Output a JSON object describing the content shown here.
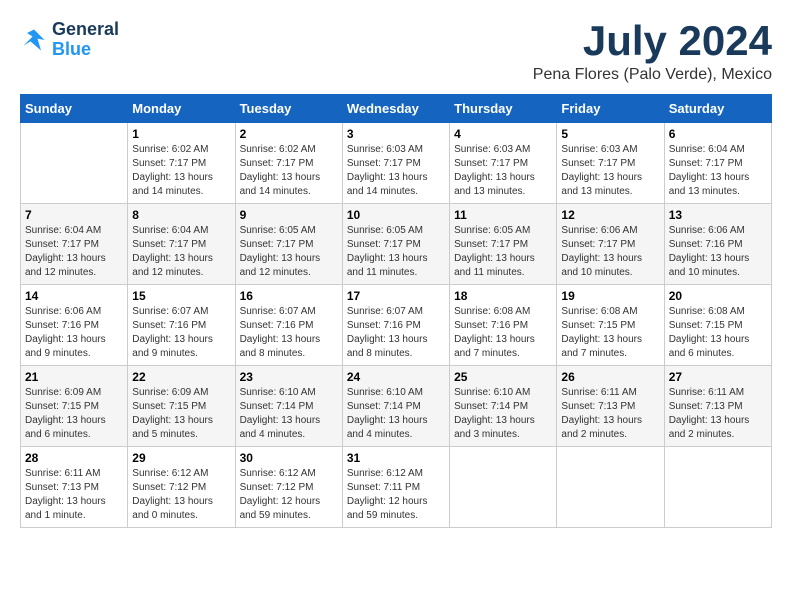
{
  "logo": {
    "line1": "General",
    "line2": "Blue"
  },
  "title": "July 2024",
  "subtitle": "Pena Flores (Palo Verde), Mexico",
  "days_header": [
    "Sunday",
    "Monday",
    "Tuesday",
    "Wednesday",
    "Thursday",
    "Friday",
    "Saturday"
  ],
  "weeks": [
    [
      {
        "day": "",
        "sunrise": "",
        "sunset": "",
        "daylight": ""
      },
      {
        "day": "1",
        "sunrise": "Sunrise: 6:02 AM",
        "sunset": "Sunset: 7:17 PM",
        "daylight": "Daylight: 13 hours and 14 minutes."
      },
      {
        "day": "2",
        "sunrise": "Sunrise: 6:02 AM",
        "sunset": "Sunset: 7:17 PM",
        "daylight": "Daylight: 13 hours and 14 minutes."
      },
      {
        "day": "3",
        "sunrise": "Sunrise: 6:03 AM",
        "sunset": "Sunset: 7:17 PM",
        "daylight": "Daylight: 13 hours and 14 minutes."
      },
      {
        "day": "4",
        "sunrise": "Sunrise: 6:03 AM",
        "sunset": "Sunset: 7:17 PM",
        "daylight": "Daylight: 13 hours and 13 minutes."
      },
      {
        "day": "5",
        "sunrise": "Sunrise: 6:03 AM",
        "sunset": "Sunset: 7:17 PM",
        "daylight": "Daylight: 13 hours and 13 minutes."
      },
      {
        "day": "6",
        "sunrise": "Sunrise: 6:04 AM",
        "sunset": "Sunset: 7:17 PM",
        "daylight": "Daylight: 13 hours and 13 minutes."
      }
    ],
    [
      {
        "day": "7",
        "sunrise": "Sunrise: 6:04 AM",
        "sunset": "Sunset: 7:17 PM",
        "daylight": "Daylight: 13 hours and 12 minutes."
      },
      {
        "day": "8",
        "sunrise": "Sunrise: 6:04 AM",
        "sunset": "Sunset: 7:17 PM",
        "daylight": "Daylight: 13 hours and 12 minutes."
      },
      {
        "day": "9",
        "sunrise": "Sunrise: 6:05 AM",
        "sunset": "Sunset: 7:17 PM",
        "daylight": "Daylight: 13 hours and 12 minutes."
      },
      {
        "day": "10",
        "sunrise": "Sunrise: 6:05 AM",
        "sunset": "Sunset: 7:17 PM",
        "daylight": "Daylight: 13 hours and 11 minutes."
      },
      {
        "day": "11",
        "sunrise": "Sunrise: 6:05 AM",
        "sunset": "Sunset: 7:17 PM",
        "daylight": "Daylight: 13 hours and 11 minutes."
      },
      {
        "day": "12",
        "sunrise": "Sunrise: 6:06 AM",
        "sunset": "Sunset: 7:17 PM",
        "daylight": "Daylight: 13 hours and 10 minutes."
      },
      {
        "day": "13",
        "sunrise": "Sunrise: 6:06 AM",
        "sunset": "Sunset: 7:16 PM",
        "daylight": "Daylight: 13 hours and 10 minutes."
      }
    ],
    [
      {
        "day": "14",
        "sunrise": "Sunrise: 6:06 AM",
        "sunset": "Sunset: 7:16 PM",
        "daylight": "Daylight: 13 hours and 9 minutes."
      },
      {
        "day": "15",
        "sunrise": "Sunrise: 6:07 AM",
        "sunset": "Sunset: 7:16 PM",
        "daylight": "Daylight: 13 hours and 9 minutes."
      },
      {
        "day": "16",
        "sunrise": "Sunrise: 6:07 AM",
        "sunset": "Sunset: 7:16 PM",
        "daylight": "Daylight: 13 hours and 8 minutes."
      },
      {
        "day": "17",
        "sunrise": "Sunrise: 6:07 AM",
        "sunset": "Sunset: 7:16 PM",
        "daylight": "Daylight: 13 hours and 8 minutes."
      },
      {
        "day": "18",
        "sunrise": "Sunrise: 6:08 AM",
        "sunset": "Sunset: 7:16 PM",
        "daylight": "Daylight: 13 hours and 7 minutes."
      },
      {
        "day": "19",
        "sunrise": "Sunrise: 6:08 AM",
        "sunset": "Sunset: 7:15 PM",
        "daylight": "Daylight: 13 hours and 7 minutes."
      },
      {
        "day": "20",
        "sunrise": "Sunrise: 6:08 AM",
        "sunset": "Sunset: 7:15 PM",
        "daylight": "Daylight: 13 hours and 6 minutes."
      }
    ],
    [
      {
        "day": "21",
        "sunrise": "Sunrise: 6:09 AM",
        "sunset": "Sunset: 7:15 PM",
        "daylight": "Daylight: 13 hours and 6 minutes."
      },
      {
        "day": "22",
        "sunrise": "Sunrise: 6:09 AM",
        "sunset": "Sunset: 7:15 PM",
        "daylight": "Daylight: 13 hours and 5 minutes."
      },
      {
        "day": "23",
        "sunrise": "Sunrise: 6:10 AM",
        "sunset": "Sunset: 7:14 PM",
        "daylight": "Daylight: 13 hours and 4 minutes."
      },
      {
        "day": "24",
        "sunrise": "Sunrise: 6:10 AM",
        "sunset": "Sunset: 7:14 PM",
        "daylight": "Daylight: 13 hours and 4 minutes."
      },
      {
        "day": "25",
        "sunrise": "Sunrise: 6:10 AM",
        "sunset": "Sunset: 7:14 PM",
        "daylight": "Daylight: 13 hours and 3 minutes."
      },
      {
        "day": "26",
        "sunrise": "Sunrise: 6:11 AM",
        "sunset": "Sunset: 7:13 PM",
        "daylight": "Daylight: 13 hours and 2 minutes."
      },
      {
        "day": "27",
        "sunrise": "Sunrise: 6:11 AM",
        "sunset": "Sunset: 7:13 PM",
        "daylight": "Daylight: 13 hours and 2 minutes."
      }
    ],
    [
      {
        "day": "28",
        "sunrise": "Sunrise: 6:11 AM",
        "sunset": "Sunset: 7:13 PM",
        "daylight": "Daylight: 13 hours and 1 minute."
      },
      {
        "day": "29",
        "sunrise": "Sunrise: 6:12 AM",
        "sunset": "Sunset: 7:12 PM",
        "daylight": "Daylight: 13 hours and 0 minutes."
      },
      {
        "day": "30",
        "sunrise": "Sunrise: 6:12 AM",
        "sunset": "Sunset: 7:12 PM",
        "daylight": "Daylight: 12 hours and 59 minutes."
      },
      {
        "day": "31",
        "sunrise": "Sunrise: 6:12 AM",
        "sunset": "Sunset: 7:11 PM",
        "daylight": "Daylight: 12 hours and 59 minutes."
      },
      {
        "day": "",
        "sunrise": "",
        "sunset": "",
        "daylight": ""
      },
      {
        "day": "",
        "sunrise": "",
        "sunset": "",
        "daylight": ""
      },
      {
        "day": "",
        "sunrise": "",
        "sunset": "",
        "daylight": ""
      }
    ]
  ]
}
